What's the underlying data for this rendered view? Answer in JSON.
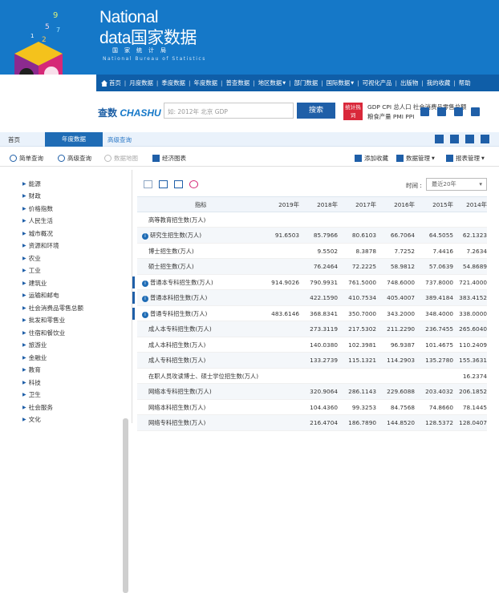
{
  "banner": {
    "line1": "National",
    "line2": "data国家数据",
    "line3": "国家统计局",
    "line4": "National Bureau of Statistics"
  },
  "topnav": [
    "首页",
    "月度数据",
    "季度数据",
    "年度数据",
    "普查数据",
    "地区数据",
    "部门数据",
    "国际数据",
    "可视化产品",
    "出版物",
    "我的收藏",
    "帮助"
  ],
  "search": {
    "logo_a": "查数",
    "logo_b": "CHASHU",
    "placeholder": "如: 2012年 北京 GDP",
    "button": "搜索",
    "hot_badge": "统计热词",
    "hot1": "GDP  CPI  总人口  社会消费品零售总额",
    "hot2": "粮食产量  PMI  PPI"
  },
  "nav": {
    "home": "首页",
    "tab": "年度数据",
    "advanced": "高级查询"
  },
  "subtool": {
    "simple": "简单查询",
    "advanced": "高级查询",
    "chart": "数据地图",
    "econ": "经济图表",
    "add_fav": "添加收藏",
    "data_mgmt": "数据管理",
    "report_mgmt": "报表管理"
  },
  "sidebar": [
    "能源",
    "财政",
    "价格指数",
    "人民生活",
    "城市概况",
    "资源和环境",
    "农业",
    "工业",
    "建筑业",
    "运输和邮电",
    "社会消费品零售总额",
    "批发和零售业",
    "住宿和餐饮业",
    "旅游业",
    "金融业",
    "教育",
    "科技",
    "卫生",
    "社会服务",
    "文化"
  ],
  "time": {
    "label": "时间 :",
    "value": "最近20年"
  },
  "table": {
    "header": {
      "ind": "指标",
      "years": [
        "2019年",
        "2018年",
        "2017年",
        "2016年",
        "2015年",
        "2014年"
      ]
    },
    "rows": [
      {
        "ind": "高等教育招生数(万人)",
        "vals": [
          "",
          "",
          "",
          "",
          "",
          ""
        ]
      },
      {
        "ind": "研究生招生数(万人)",
        "vals": [
          "91.6503",
          "85.7966",
          "80.6103",
          "66.7064",
          "64.5055",
          "62.1323"
        ]
      },
      {
        "ind": "博士招生数(万人)",
        "vals": [
          "",
          "9.5502",
          "8.3878",
          "7.7252",
          "7.4416",
          "7.2634"
        ]
      },
      {
        "ind": "硕士招生数(万人)",
        "vals": [
          "",
          "76.2464",
          "72.2225",
          "58.9812",
          "57.0639",
          "54.8689"
        ]
      },
      {
        "ind": "普通本专科招生数(万人)",
        "vals": [
          "914.9026",
          "790.9931",
          "761.5000",
          "748.6000",
          "737.8000",
          "721.4000"
        ]
      },
      {
        "ind": "普通本科招生数(万人)",
        "vals": [
          "",
          "422.1590",
          "410.7534",
          "405.4007",
          "389.4184",
          "383.4152"
        ]
      },
      {
        "ind": "普通专科招生数(万人)",
        "vals": [
          "483.6146",
          "368.8341",
          "350.7000",
          "343.2000",
          "348.4000",
          "338.0000"
        ]
      },
      {
        "ind": "成人本专科招生数(万人)",
        "vals": [
          "",
          "273.3119",
          "217.5302",
          "211.2290",
          "236.7455",
          "265.6040"
        ]
      },
      {
        "ind": "成人本科招生数(万人)",
        "vals": [
          "",
          "140.0380",
          "102.3981",
          "96.9387",
          "101.4675",
          "110.2409"
        ]
      },
      {
        "ind": "成人专科招生数(万人)",
        "vals": [
          "",
          "133.2739",
          "115.1321",
          "114.2903",
          "135.2780",
          "155.3631"
        ]
      },
      {
        "ind": "在职人员攻读博士、硕士学位招生数(万人)",
        "vals": [
          "",
          "",
          "",
          "",
          "",
          "16.2374"
        ]
      },
      {
        "ind": "网络本专科招生数(万人)",
        "vals": [
          "",
          "320.9064",
          "286.1143",
          "229.6088",
          "203.4032",
          "206.1852"
        ]
      },
      {
        "ind": "网络本科招生数(万人)",
        "vals": [
          "",
          "104.4360",
          "99.3253",
          "84.7568",
          "74.8660",
          "78.1445"
        ]
      },
      {
        "ind": "网络专科招生数(万人)",
        "vals": [
          "",
          "216.4704",
          "186.7890",
          "144.8520",
          "128.5372",
          "128.0407"
        ]
      }
    ]
  }
}
